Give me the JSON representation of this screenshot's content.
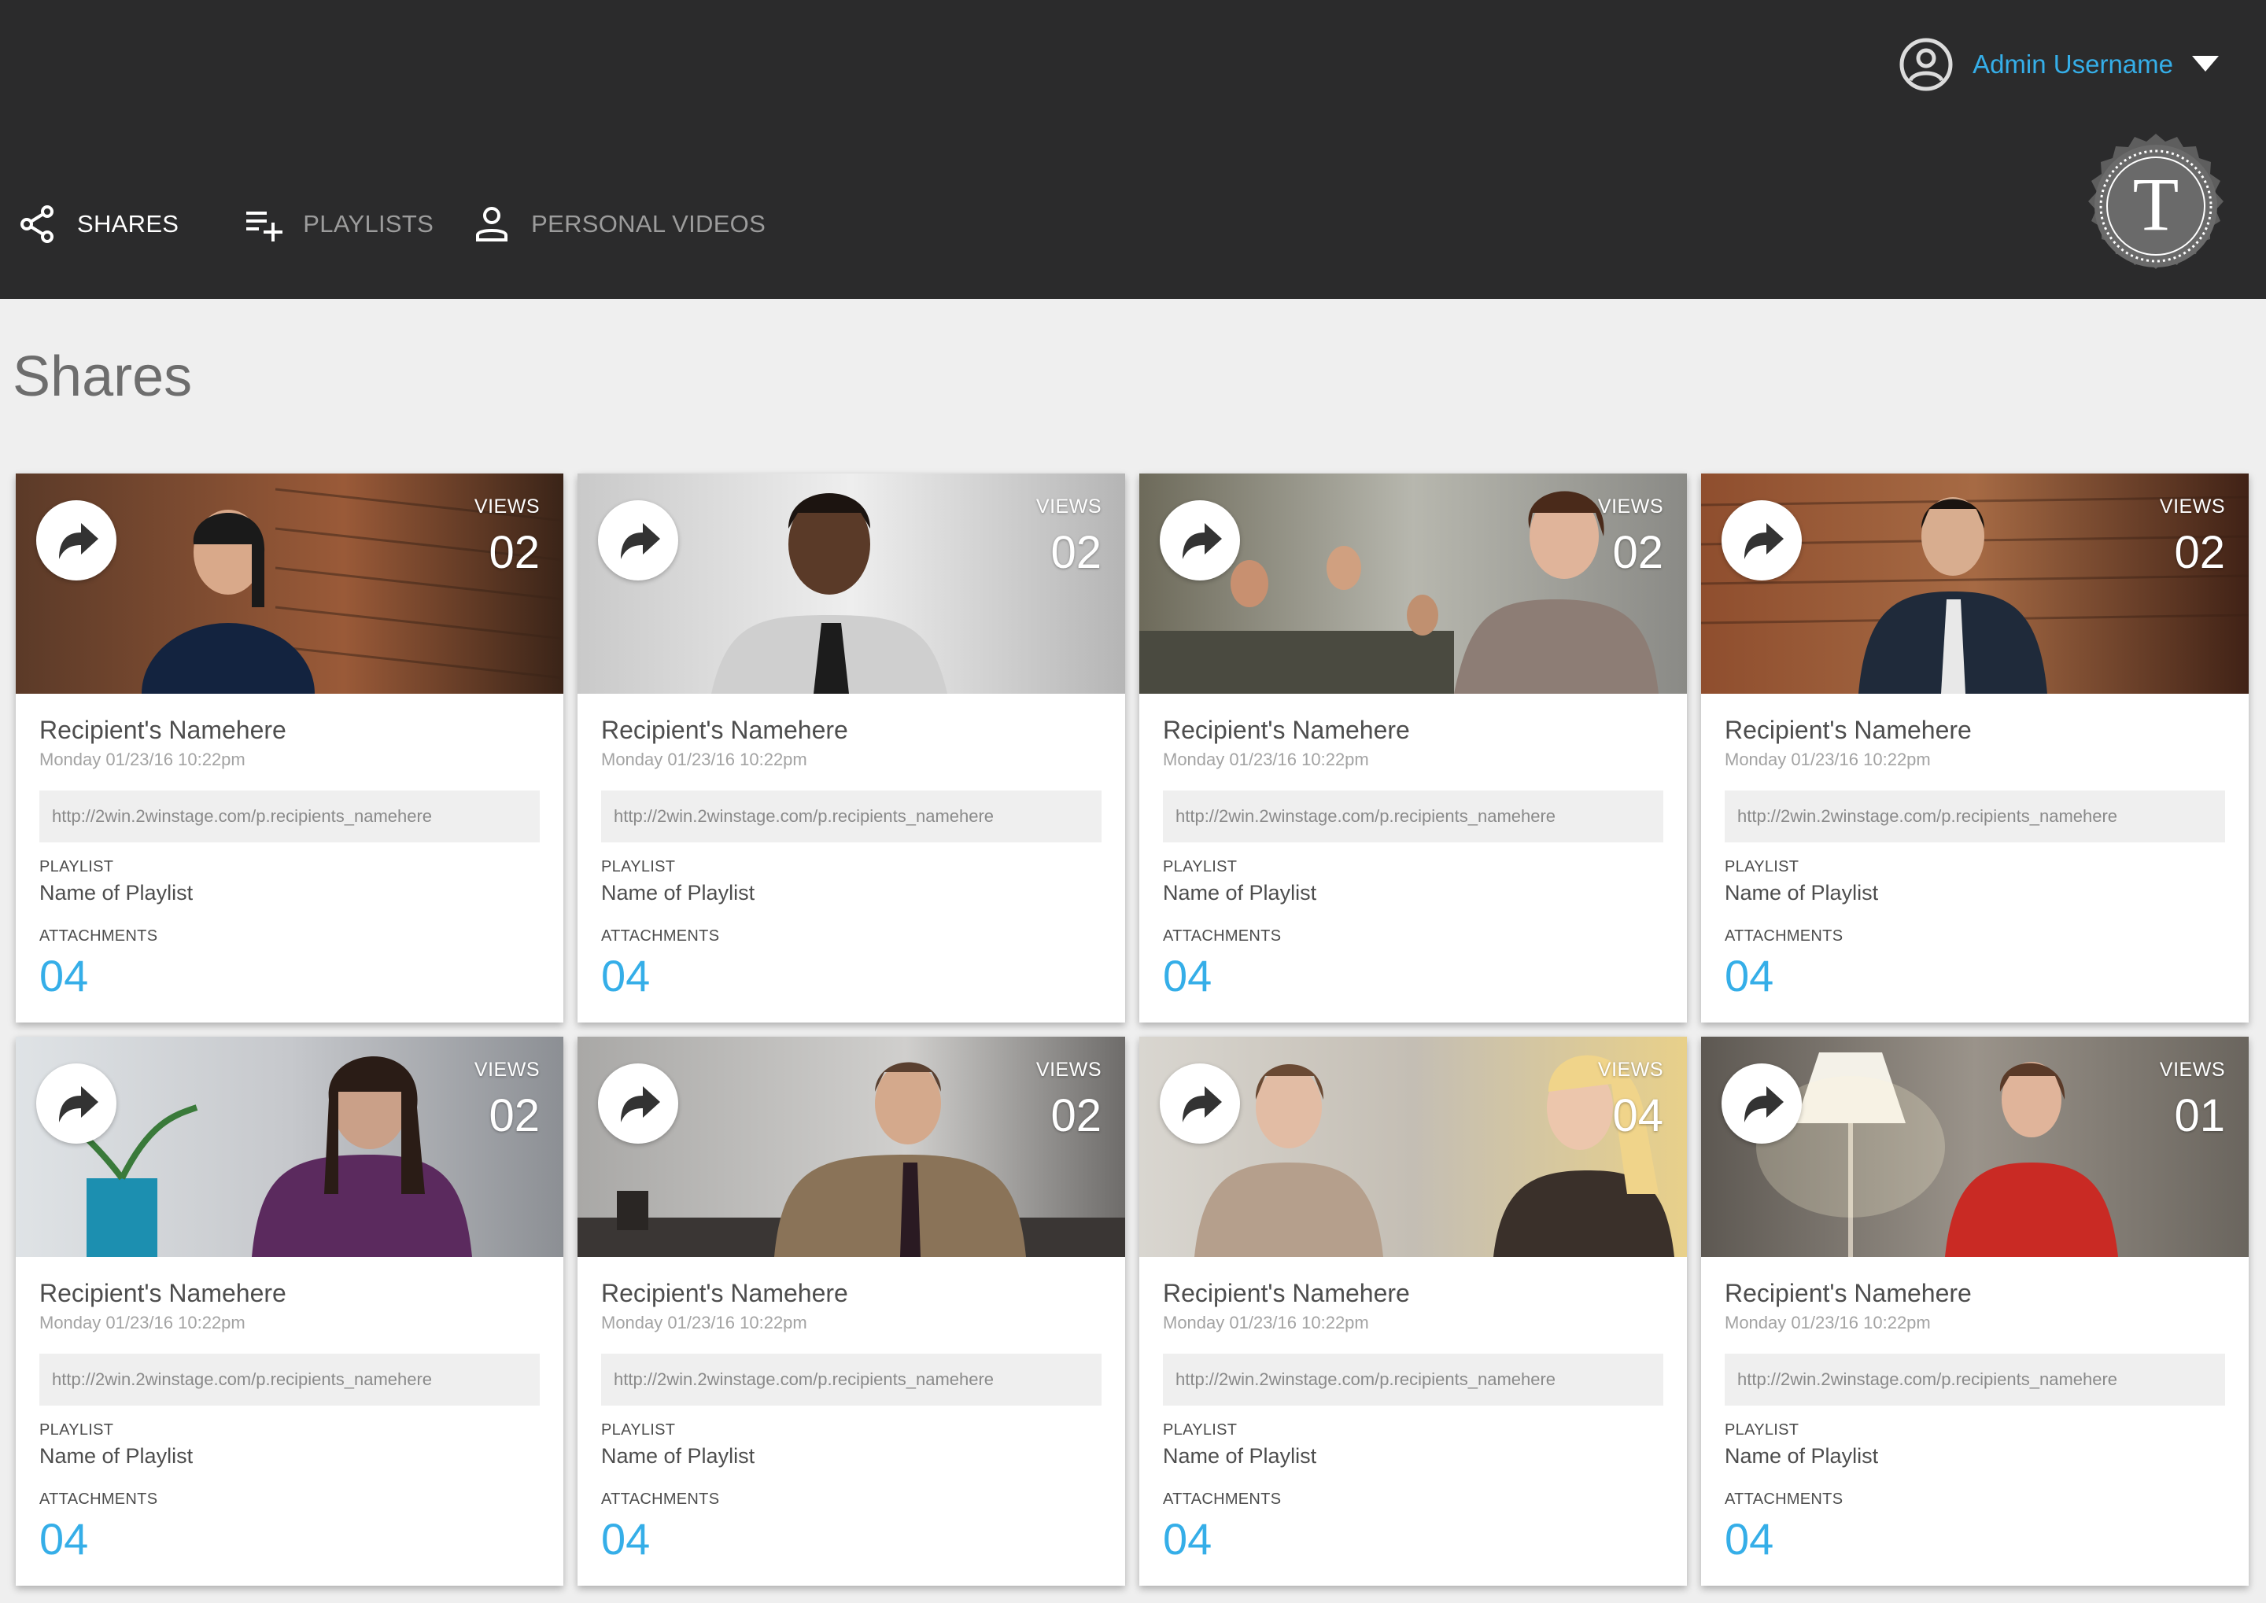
{
  "header": {
    "username": "Admin Username",
    "nav": [
      {
        "label": "SHARES",
        "icon": "share-icon",
        "active": true
      },
      {
        "label": "PLAYLISTS",
        "icon": "playlist-add-icon",
        "active": false
      },
      {
        "label": "PERSONAL VIDEOS",
        "icon": "person-icon",
        "active": false
      }
    ],
    "logo_letter": "T"
  },
  "page": {
    "title": "Shares"
  },
  "card_labels": {
    "views": "VIEWS",
    "playlist": "PLAYLIST",
    "attachments": "ATTACHMENTS"
  },
  "cards": [
    {
      "views": "02",
      "recipient": "Recipient's Namehere",
      "date": "Monday 01/23/16 10:22pm",
      "url": "http://2win.2winstage.com/p.recipients_namehere",
      "playlist": "Name of Playlist",
      "attachments": "04"
    },
    {
      "views": "02",
      "recipient": "Recipient's Namehere",
      "date": "Monday 01/23/16 10:22pm",
      "url": "http://2win.2winstage.com/p.recipients_namehere",
      "playlist": "Name of Playlist",
      "attachments": "04"
    },
    {
      "views": "02",
      "recipient": "Recipient's Namehere",
      "date": "Monday 01/23/16 10:22pm",
      "url": "http://2win.2winstage.com/p.recipients_namehere",
      "playlist": "Name of Playlist",
      "attachments": "04"
    },
    {
      "views": "02",
      "recipient": "Recipient's Namehere",
      "date": "Monday 01/23/16 10:22pm",
      "url": "http://2win.2winstage.com/p.recipients_namehere",
      "playlist": "Name of Playlist",
      "attachments": "04"
    },
    {
      "views": "02",
      "recipient": "Recipient's Namehere",
      "date": "Monday 01/23/16 10:22pm",
      "url": "http://2win.2winstage.com/p.recipients_namehere",
      "playlist": "Name of Playlist",
      "attachments": "04"
    },
    {
      "views": "02",
      "recipient": "Recipient's Namehere",
      "date": "Monday 01/23/16 10:22pm",
      "url": "http://2win.2winstage.com/p.recipients_namehere",
      "playlist": "Name of Playlist",
      "attachments": "04"
    },
    {
      "views": "04",
      "recipient": "Recipient's Namehere",
      "date": "Monday 01/23/16 10:22pm",
      "url": "http://2win.2winstage.com/p.recipients_namehere",
      "playlist": "Name of Playlist",
      "attachments": "04"
    },
    {
      "views": "01",
      "recipient": "Recipient's Namehere",
      "date": "Monday 01/23/16 10:22pm",
      "url": "http://2win.2winstage.com/p.recipients_namehere",
      "playlist": "Name of Playlist",
      "attachments": "04"
    }
  ],
  "colors": {
    "header_bg": "#2b2b2c",
    "accent": "#35aee8",
    "page_bg": "#efefef",
    "card_bg": "#ffffff",
    "nav_inactive": "#9c9c9c"
  }
}
